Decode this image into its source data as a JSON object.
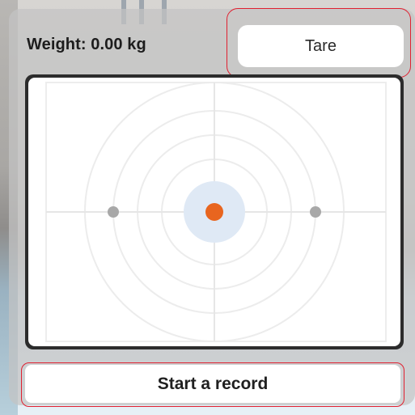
{
  "header": {
    "weight_text": "Weight: 0.00 kg"
  },
  "toolbar": {
    "tare_label": "Tare"
  },
  "footer": {
    "record_label": "Start a record"
  },
  "colors": {
    "highlight_border": "#e02030",
    "center_dot": "#e8651f",
    "center_halo": "#dfe9f5",
    "side_dot": "#a8a8a8",
    "grid_line": "#e6e6e6"
  }
}
